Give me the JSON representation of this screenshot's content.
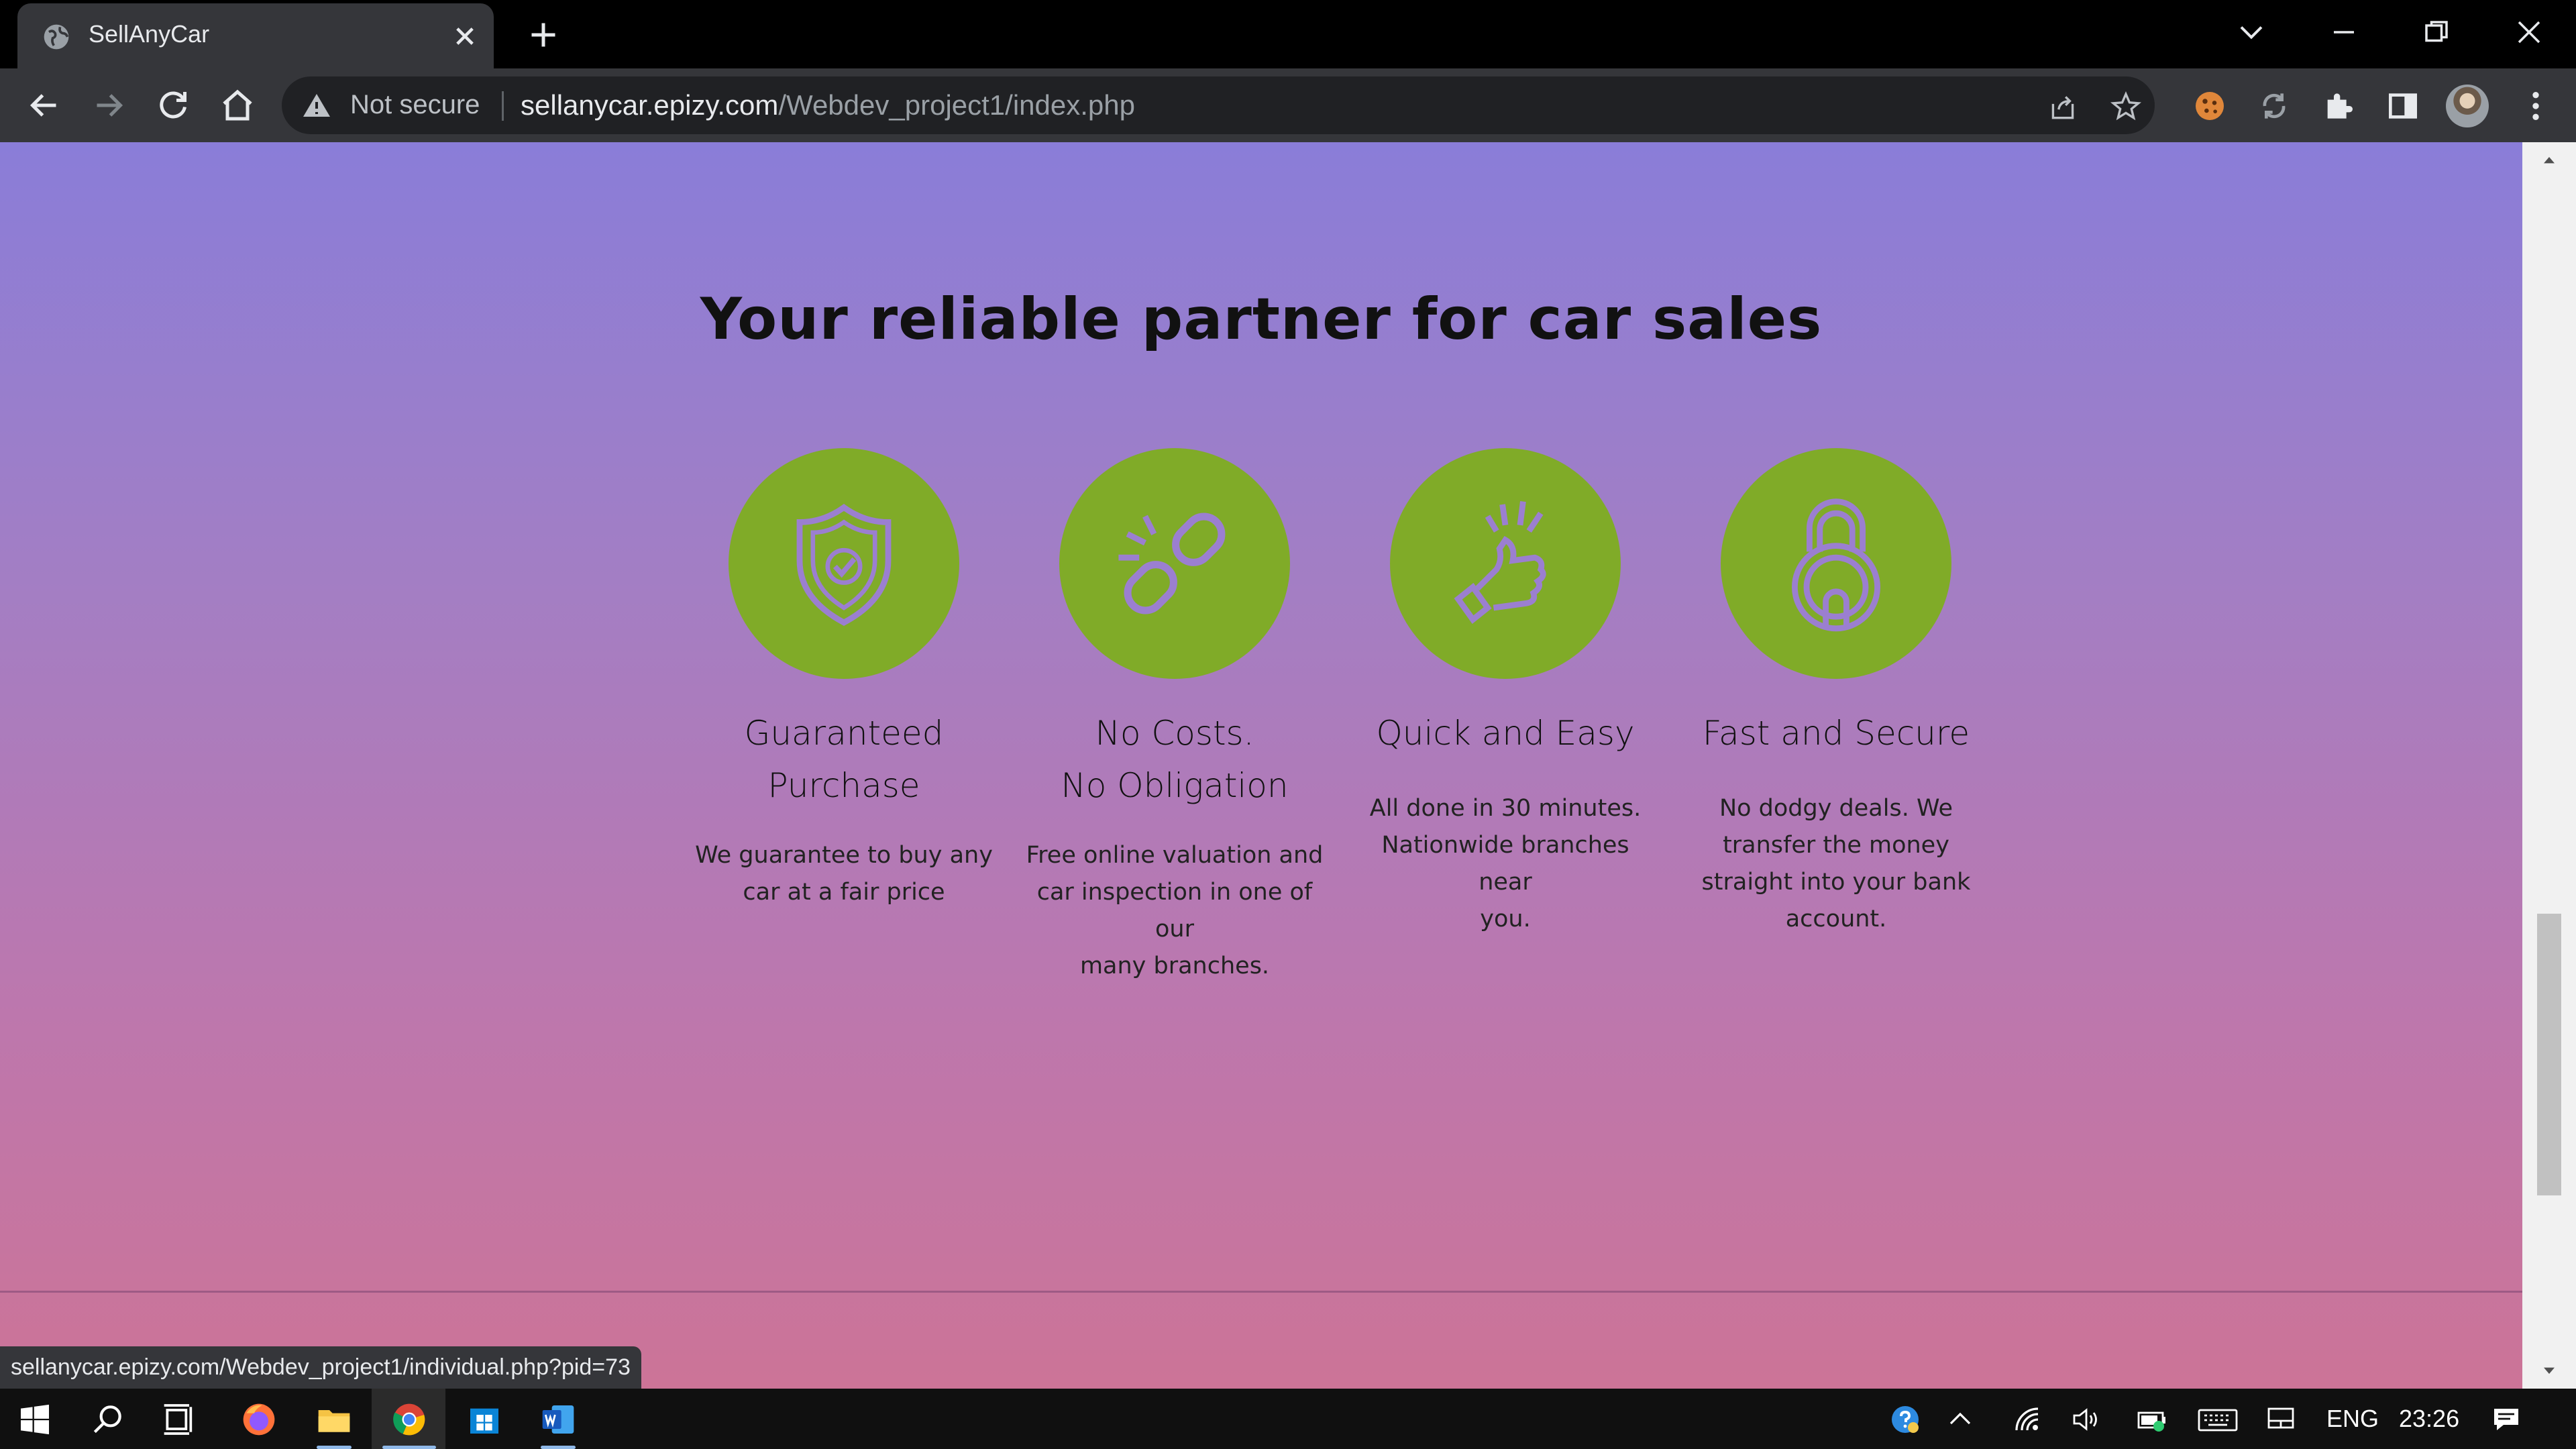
{
  "browser": {
    "tab_title": "SellAnyCar",
    "security_label": "Not secure",
    "url_host": "sellanycar.epizy.com",
    "url_path": "/Webdev_project1/index.php",
    "status_url": "sellanycar.epizy.com/Webdev_project1/individual.php?pid=73"
  },
  "page": {
    "headline": "Your reliable partner for car sales",
    "features": [
      {
        "icon": "shield-check-icon",
        "title_line1": "Guaranteed",
        "title_line2": "Purchase",
        "desc_lines": [
          "We guarantee to buy any",
          "car at a fair price"
        ]
      },
      {
        "icon": "broken-link-icon",
        "title_line1": "No Costs.",
        "title_line2": "No Obligation",
        "desc_lines": [
          "Free online valuation and",
          "car inspection in one of our",
          "many branches."
        ]
      },
      {
        "icon": "thumbs-up-icon",
        "title_line1": "Quick and Easy",
        "desc_lines": [
          "All done in 30 minutes.",
          "Nationwide branches near",
          "you."
        ]
      },
      {
        "icon": "padlock-icon",
        "title_line1": "Fast and Secure",
        "desc_lines": [
          "No dodgy deals. We",
          "transfer the money",
          "straight into your bank",
          "account."
        ]
      }
    ],
    "accent_color": "#80ab28",
    "icon_stroke_color": "#9b7fd0"
  },
  "taskbar": {
    "language": "ENG",
    "time": "23:26"
  }
}
